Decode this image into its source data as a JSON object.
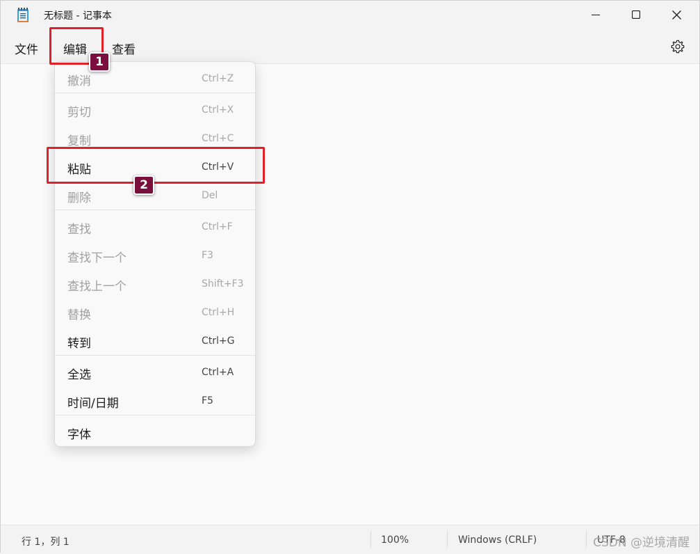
{
  "window": {
    "title": "无标题 - 记事本"
  },
  "menubar": {
    "file": "文件",
    "edit": "编辑",
    "view": "查看"
  },
  "edit_menu": {
    "items": [
      {
        "label": "撤消",
        "shortcut": "Ctrl+Z",
        "enabled": false
      },
      {
        "label": "剪切",
        "shortcut": "Ctrl+X",
        "enabled": false
      },
      {
        "label": "复制",
        "shortcut": "Ctrl+C",
        "enabled": false
      },
      {
        "label": "粘贴",
        "shortcut": "Ctrl+V",
        "enabled": true
      },
      {
        "label": "删除",
        "shortcut": "Del",
        "enabled": false
      },
      {
        "label": "查找",
        "shortcut": "Ctrl+F",
        "enabled": false
      },
      {
        "label": "查找下一个",
        "shortcut": "F3",
        "enabled": false
      },
      {
        "label": "查找上一个",
        "shortcut": "Shift+F3",
        "enabled": false
      },
      {
        "label": "替换",
        "shortcut": "Ctrl+H",
        "enabled": false
      },
      {
        "label": "转到",
        "shortcut": "Ctrl+G",
        "enabled": true
      },
      {
        "label": "全选",
        "shortcut": "Ctrl+A",
        "enabled": true
      },
      {
        "label": "时间/日期",
        "shortcut": "F5",
        "enabled": true
      },
      {
        "label": "字体",
        "shortcut": "",
        "enabled": true
      }
    ]
  },
  "statusbar": {
    "position": "行 1，列 1",
    "zoom": "100%",
    "line_ending": "Windows (CRLF)",
    "encoding": "UTF-8"
  },
  "watermark": "CSDN @逆境清醒",
  "annotations": {
    "badge1": "1",
    "badge2": "2"
  },
  "colors": {
    "highlight": "#e0202a",
    "badge": "#7a0f3e",
    "disabled_text": "#a0a0a0"
  },
  "icons": [
    "notepad-app-icon",
    "minimize-icon",
    "maximize-icon",
    "close-icon",
    "settings-gear-icon"
  ]
}
